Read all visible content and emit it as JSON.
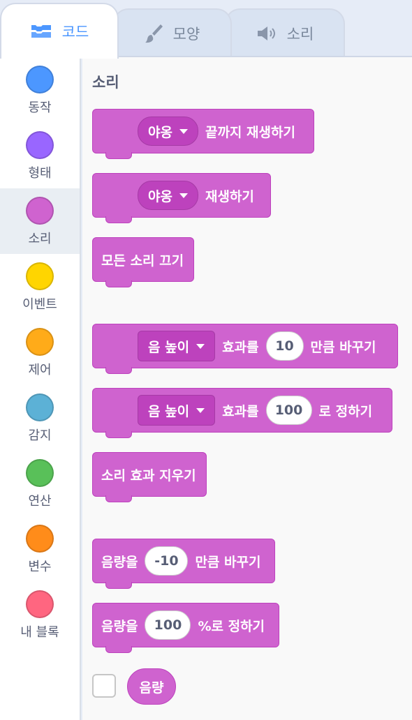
{
  "tabs": [
    {
      "label": "코드",
      "icon": "code-blocks-icon"
    },
    {
      "label": "모양",
      "icon": "paintbrush-icon"
    },
    {
      "label": "소리",
      "icon": "speaker-icon"
    }
  ],
  "categories": [
    {
      "label": "동작",
      "color": "#4c97ff"
    },
    {
      "label": "형태",
      "color": "#9966ff"
    },
    {
      "label": "소리",
      "color": "#cf63cf"
    },
    {
      "label": "이벤트",
      "color": "#ffd500"
    },
    {
      "label": "제어",
      "color": "#ffab19"
    },
    {
      "label": "감지",
      "color": "#5cb1d6"
    },
    {
      "label": "연산",
      "color": "#59c059"
    },
    {
      "label": "변수",
      "color": "#ff8c1a"
    },
    {
      "label": "내 블록",
      "color": "#ff6680"
    }
  ],
  "section_title": "소리",
  "blocks": {
    "play_until_done": {
      "sound": "야옹",
      "text": "끝까지 재생하기"
    },
    "start_sound": {
      "sound": "야옹",
      "text": "재생하기"
    },
    "stop_all": {
      "text": "모든 소리 끄기"
    },
    "change_effect": {
      "effect": "음 높이",
      "text1": "효과를",
      "value": "10",
      "text2": "만큼 바꾸기"
    },
    "set_effect": {
      "effect": "음 높이",
      "text1": "효과를",
      "value": "100",
      "text2": "로 정하기"
    },
    "clear_effects": {
      "text": "소리 효과 지우기"
    },
    "change_volume": {
      "text1": "음량을",
      "value": "-10",
      "text2": "만큼 바꾸기"
    },
    "set_volume": {
      "text1": "음량을",
      "value": "100",
      "text2": "%로 정하기"
    },
    "volume_reporter": {
      "text": "음량"
    }
  },
  "colors": {
    "sound_block": "#cf63cf",
    "sound_block_border": "#bd42bd",
    "accent": "#4c97ff"
  }
}
